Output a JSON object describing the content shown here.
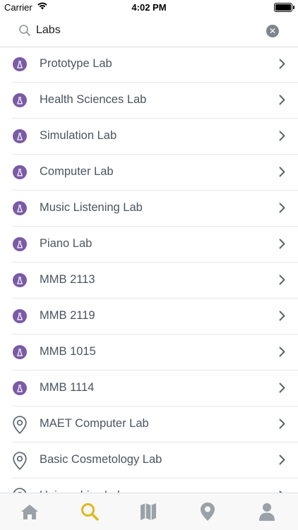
{
  "status_bar": {
    "carrier": "Carrier",
    "time": "4:02 PM"
  },
  "search": {
    "query": "Labs"
  },
  "results": [
    {
      "label": "Prototype Lab",
      "icon": "lab-flask-icon"
    },
    {
      "label": "Health Sciences Lab",
      "icon": "lab-flask-icon"
    },
    {
      "label": "Simulation Lab",
      "icon": "lab-flask-icon"
    },
    {
      "label": "Computer Lab",
      "icon": "lab-flask-icon"
    },
    {
      "label": "Music Listening Lab",
      "icon": "lab-flask-icon"
    },
    {
      "label": "Piano Lab",
      "icon": "lab-flask-icon"
    },
    {
      "label": "MMB 2113",
      "icon": "lab-flask-icon"
    },
    {
      "label": "MMB 2119",
      "icon": "lab-flask-icon"
    },
    {
      "label": "MMB 1015",
      "icon": "lab-flask-icon"
    },
    {
      "label": "MMB 1114",
      "icon": "lab-flask-icon"
    },
    {
      "label": "MAET Computer Lab",
      "icon": "location-pin-icon"
    },
    {
      "label": "Basic Cosmetology Lab",
      "icon": "location-pin-icon"
    },
    {
      "label": "Unigraphics Lab",
      "icon": "location-pin-icon"
    }
  ],
  "tab_bar": {
    "tabs": [
      {
        "name": "home",
        "icon": "home-icon",
        "active": false
      },
      {
        "name": "search",
        "icon": "search-icon",
        "active": true
      },
      {
        "name": "map",
        "icon": "map-icon",
        "active": false
      },
      {
        "name": "places",
        "icon": "location-pin-icon",
        "active": false
      },
      {
        "name": "profile",
        "icon": "person-icon",
        "active": false
      }
    ]
  },
  "colors": {
    "lab_icon": "#7b5aa6",
    "active_tab": "#e0b820",
    "inactive_tab": "#9aa1a8",
    "text": "#4a5560"
  }
}
